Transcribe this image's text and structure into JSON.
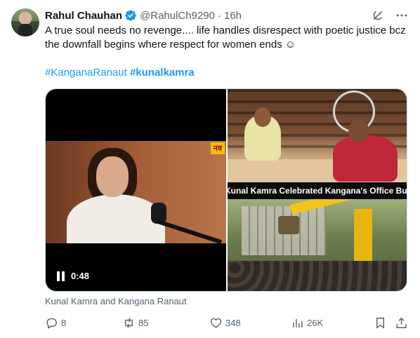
{
  "author": {
    "name": "Rahul Chauhan",
    "handle": "@RahulCh9290",
    "separator": "·",
    "time": "16h",
    "verified": true
  },
  "tweet": {
    "text": "A true soul needs no revenge.... life handles disrespect with poetic justice bcz the downfall begins where respect for women ends ☺",
    "hashtags": [
      "#KanganaRanaut",
      "#kunalkamra"
    ]
  },
  "media": {
    "video_time": "0:48",
    "video_logo": "नव",
    "banner_text": "Kunal Kamra Celebrated Kangana's Office Bulldozed",
    "caption": "Kunal Kamra and Kangana Ranaut"
  },
  "actions": {
    "replies": "8",
    "reposts": "85",
    "likes": "348",
    "views": "26K"
  },
  "icons": {
    "grok": "grok-icon",
    "more": "more-icon",
    "reply": "reply-icon",
    "repost": "repost-icon",
    "like": "like-icon",
    "views": "views-icon",
    "bookmark": "bookmark-icon",
    "share": "share-icon"
  },
  "colors": {
    "accent": "#1d9bf0",
    "secondary_text": "#536471",
    "text": "#0f1419"
  }
}
